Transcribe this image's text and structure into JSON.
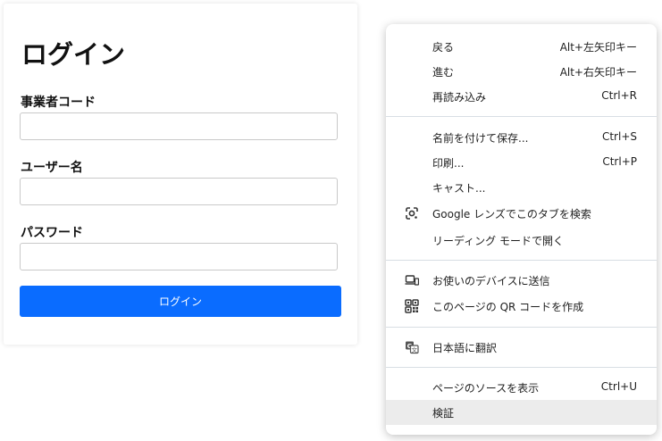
{
  "login": {
    "title": "ログイン",
    "business_code_label": "事業者コード",
    "username_label": "ユーザー名",
    "password_label": "パスワード",
    "submit_label": "ログイン"
  },
  "context_menu": {
    "back": {
      "label": "戻る",
      "shortcut": "Alt+左矢印キー"
    },
    "forward": {
      "label": "進む",
      "shortcut": "Alt+右矢印キー"
    },
    "reload": {
      "label": "再読み込み",
      "shortcut": "Ctrl+R"
    },
    "save_as": {
      "label": "名前を付けて保存...",
      "shortcut": "Ctrl+S"
    },
    "print": {
      "label": "印刷...",
      "shortcut": "Ctrl+P"
    },
    "cast": {
      "label": "キャスト..."
    },
    "google_lens": {
      "label": "Google レンズでこのタブを検索",
      "icon": "google-lens-icon"
    },
    "reading_mode": {
      "label": "リーディング モードで開く"
    },
    "send_to_devices": {
      "label": "お使いのデバイスに送信",
      "icon": "devices-icon"
    },
    "qr_code": {
      "label": "このページの QR コードを作成",
      "icon": "qr-code-icon"
    },
    "translate": {
      "label": "日本語に翻訳",
      "icon": "translate-icon"
    },
    "view_source": {
      "label": "ページのソースを表示",
      "shortcut": "Ctrl+U"
    },
    "inspect": {
      "label": "検証"
    }
  },
  "colors": {
    "primary_button": "#0a6cff",
    "menu_hover": "#ececec"
  }
}
